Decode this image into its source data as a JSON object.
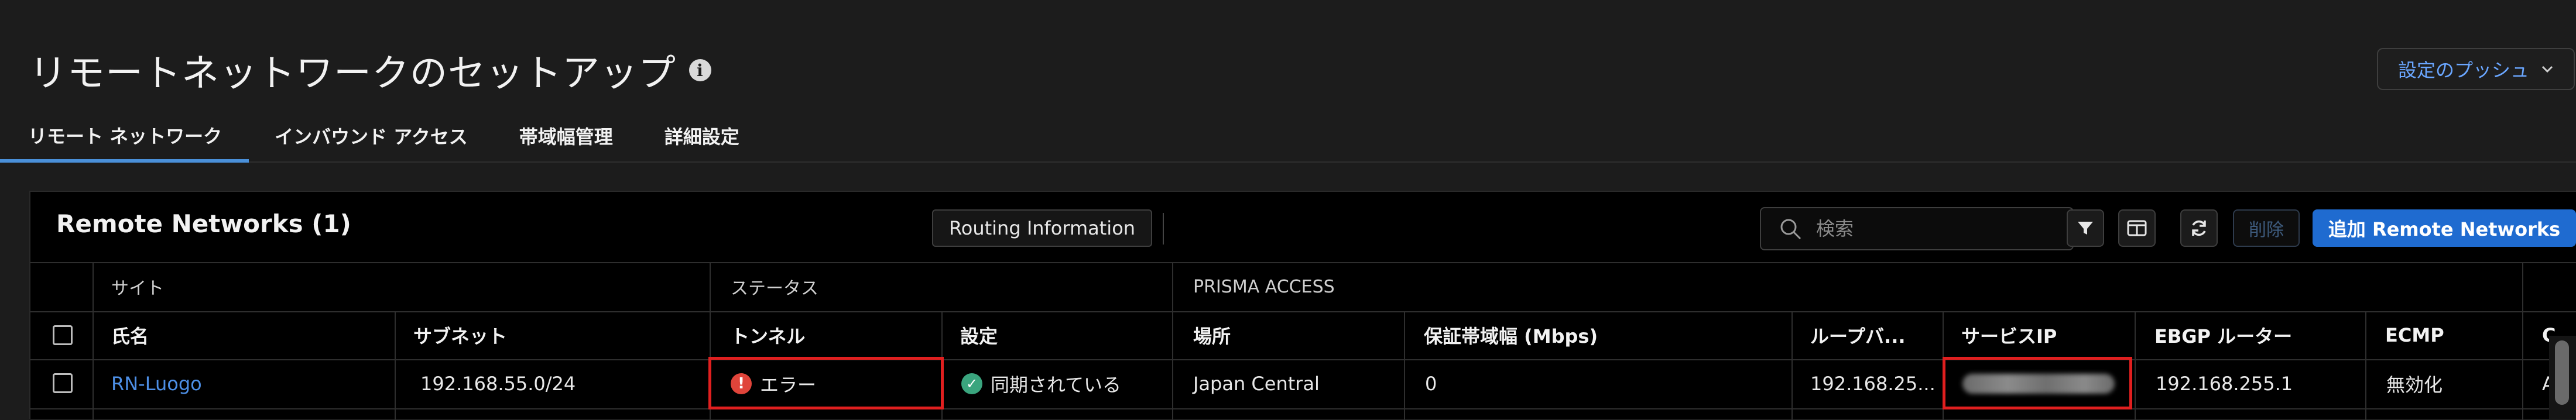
{
  "header": {
    "title": "リモートネットワークのセットアップ",
    "push_label": "設定のプッシュ"
  },
  "tabs": [
    {
      "label": "リモート ネットワーク",
      "active": true
    },
    {
      "label": "インバウンド アクセス",
      "active": false
    },
    {
      "label": "帯域幅管理",
      "active": false
    },
    {
      "label": "詳細設定",
      "active": false
    }
  ],
  "panel": {
    "title": "Remote Networks (1)",
    "routing_label": "Routing Information",
    "search_placeholder": "検索",
    "delete_label": "削除",
    "add_label": "追加 Remote Networks"
  },
  "table": {
    "groups": [
      "サイト",
      "ステータス",
      "PRISMA ACCESS"
    ],
    "columns": [
      "氏名",
      "サブネット",
      "トンネル",
      "設定",
      "場所",
      "保証帯域幅 (Mbps)",
      "ループバ...",
      "サービスIP",
      "EBGP ルーター",
      "ECMP",
      "C"
    ],
    "rows": [
      {
        "name": "RN-Luogo",
        "subnet": "192.168.55.0/24",
        "tunnel": "エラー",
        "config": "同期されている",
        "location": "Japan Central",
        "bandwidth": "0",
        "loopback": "192.168.25...",
        "service_ip": "",
        "ebgp": "192.168.255.1",
        "ecmp": "無効化",
        "extra": "A"
      }
    ]
  },
  "colors": {
    "accent": "#1f6bd0",
    "link": "#4d8fe6",
    "error": "#e0443a",
    "success": "#3aa57e",
    "highlight_box": "#e01f1f"
  },
  "icons": [
    "info-icon",
    "chevron-down-icon",
    "search-icon",
    "filter-icon",
    "columns-icon",
    "refresh-icon",
    "error-icon",
    "check-circle-icon"
  ]
}
